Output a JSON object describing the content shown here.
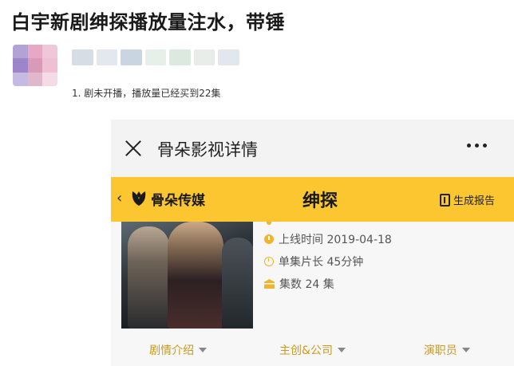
{
  "post": {
    "title": "白宇新剧绅探播放量注水，带锤",
    "caption": "1. 剧未开播，播放量已经买到22集"
  },
  "avatar": {
    "blur_colors": [
      "#b3a2d4",
      "#e7a8c6",
      "#f0c7d9",
      "#9c86c9",
      "#d79ab8",
      "#eec0d2",
      "#c6b9e2",
      "#e0b8cc",
      "#f4dbe6"
    ]
  },
  "username_blur": {
    "colors": [
      "#d7dde4",
      "#e3e8ee",
      "#c9d6e2",
      "#e6efe8",
      "#dbe9df",
      "#e8ede9",
      "#e1e7ec"
    ]
  },
  "app": {
    "topbar_title": "骨朵影视详情",
    "brand_name": "骨朵传媒",
    "show_title": "绅探",
    "report_label": "生成报告",
    "accent_color": "#fbc630",
    "icon_color": "#f0b52a"
  },
  "details": {
    "release": "上线时间 2019-04-18",
    "episode_length": "单集片长 45分钟",
    "episodes": "集数 24 集"
  },
  "tabs": [
    {
      "label": "剧情介绍"
    },
    {
      "label": "主创&公司"
    },
    {
      "label": "演职员"
    }
  ]
}
